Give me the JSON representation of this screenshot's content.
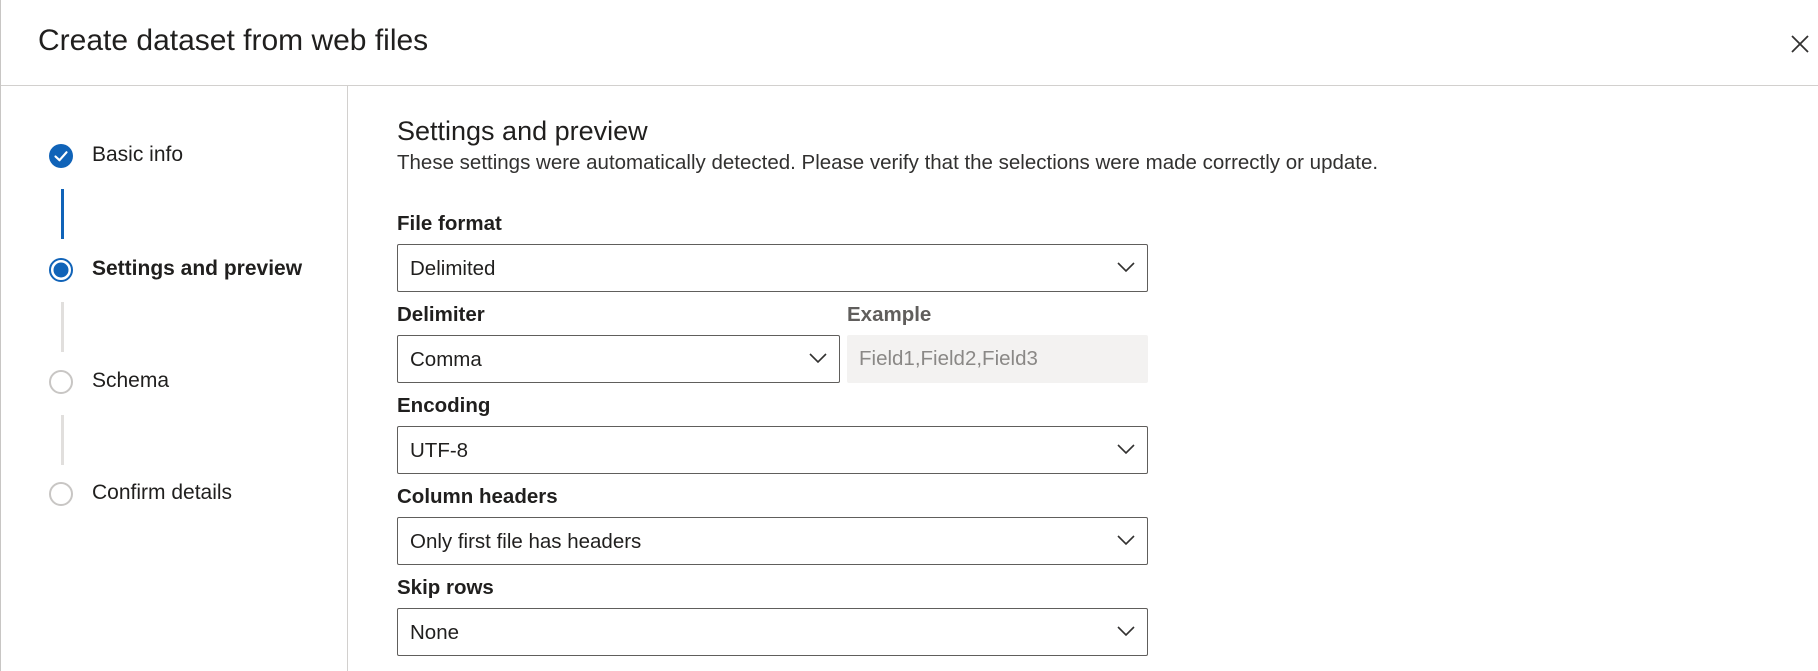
{
  "dialog": {
    "title": "Create dataset from web files",
    "close_icon": "close-icon"
  },
  "steps": [
    {
      "label": "Basic info",
      "state": "completed",
      "icon": "check-circle-icon"
    },
    {
      "label": "Settings and preview",
      "state": "current",
      "icon": "current-step-icon"
    },
    {
      "label": "Schema",
      "state": "pending",
      "icon": "empty-circle-icon"
    },
    {
      "label": "Confirm details",
      "state": "pending",
      "icon": "empty-circle-icon"
    }
  ],
  "main": {
    "title": "Settings and preview",
    "description": "These settings were automatically detected. Please verify that the selections were made correctly or update.",
    "file_format": {
      "label": "File format",
      "value": "Delimited"
    },
    "delimiter": {
      "label": "Delimiter",
      "value": "Comma"
    },
    "example": {
      "label": "Example",
      "value": "Field1,Field2,Field3"
    },
    "encoding": {
      "label": "Encoding",
      "value": "UTF-8"
    },
    "column_headers": {
      "label": "Column headers",
      "value": "Only first file has headers"
    },
    "skip_rows": {
      "label": "Skip rows",
      "value": "None"
    }
  },
  "colors": {
    "accent": "#1063b8",
    "border": "#605e5c",
    "readonly_bg": "#f3f2f1"
  }
}
